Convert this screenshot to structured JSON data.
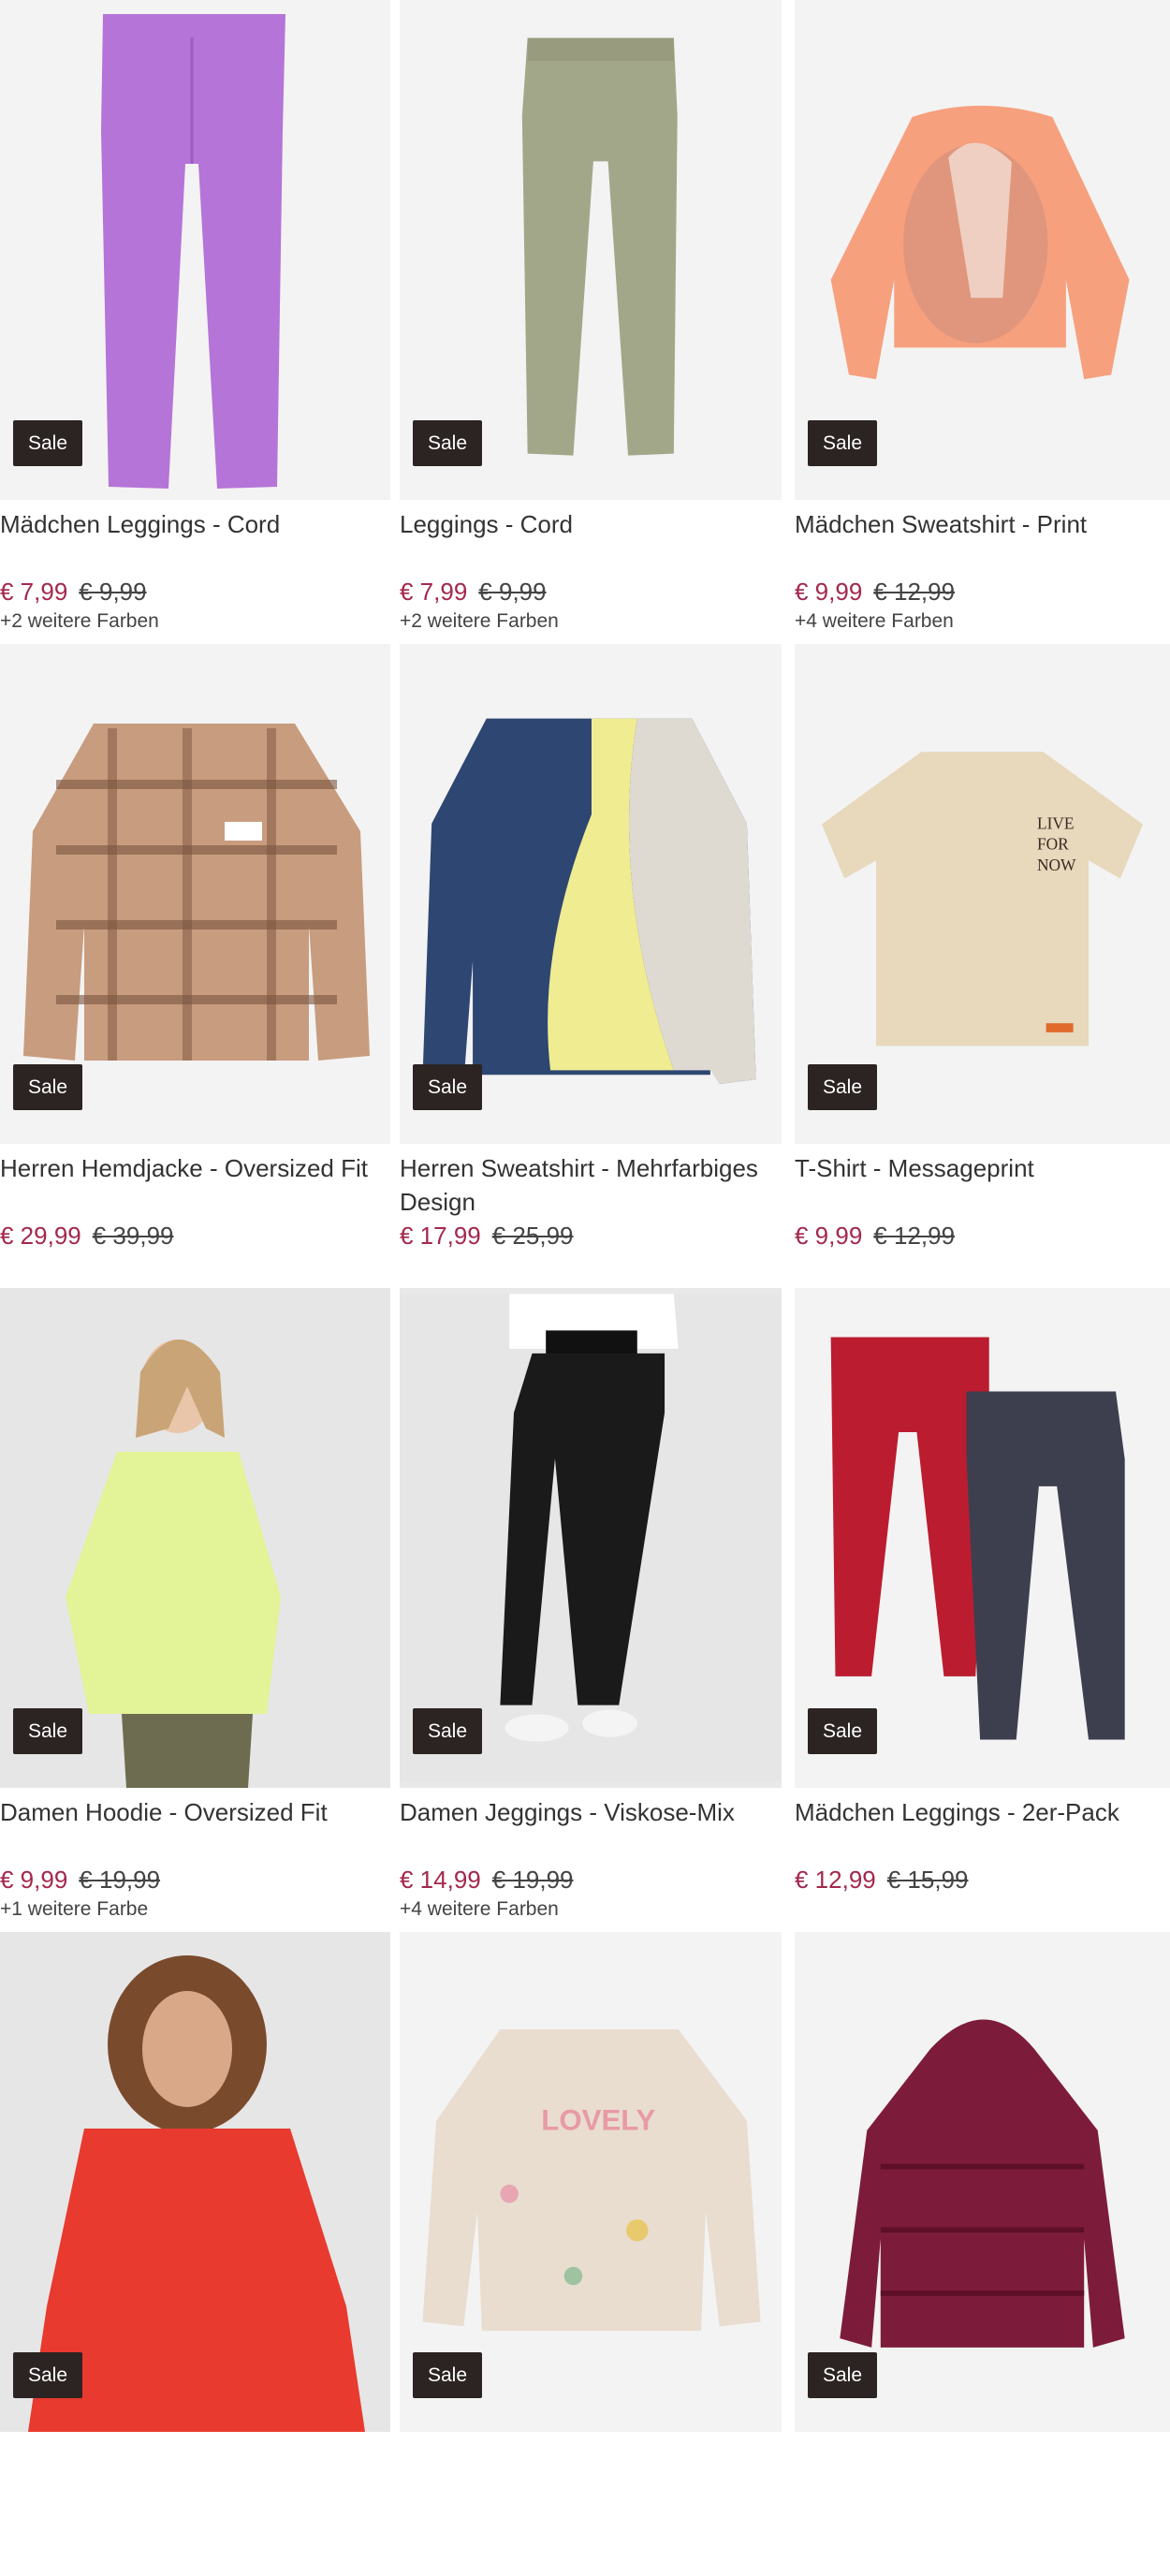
{
  "sale_label": "Sale",
  "colors": {
    "price": "#a3284c",
    "badge_bg": "#2b2422"
  },
  "products": [
    {
      "title": "Mädchen Leggings - Cord",
      "price": "€ 7,99",
      "old_price": "€ 9,99",
      "colors_note": "+2 weitere Farben"
    },
    {
      "title": "Leggings - Cord",
      "price": "€ 7,99",
      "old_price": "€ 9,99",
      "colors_note": "+2 weitere Farben"
    },
    {
      "title": "Mädchen Sweatshirt - Print",
      "price": "€ 9,99",
      "old_price": "€ 12,99",
      "colors_note": "+4 weitere Farben"
    },
    {
      "title": "Herren Hemdjacke - Oversized Fit",
      "price": "€ 29,99",
      "old_price": "€ 39,99",
      "colors_note": ""
    },
    {
      "title": "Herren Sweatshirt - Mehrfarbiges Design",
      "price": "€ 17,99",
      "old_price": "€ 25,99",
      "colors_note": ""
    },
    {
      "title": "T-Shirt - Messageprint",
      "price": "€ 9,99",
      "old_price": "€ 12,99",
      "colors_note": ""
    },
    {
      "title": "Damen Hoodie - Oversized Fit",
      "price": "€ 9,99",
      "old_price": "€ 19,99",
      "colors_note": "+1 weitere Farbe"
    },
    {
      "title": "Damen Jeggings - Viskose-Mix",
      "price": "€ 14,99",
      "old_price": "€ 19,99",
      "colors_note": "+4 weitere Farben"
    },
    {
      "title": "Mädchen Leggings - 2er-Pack",
      "price": "€ 12,99",
      "old_price": "€ 15,99",
      "colors_note": ""
    },
    {
      "title": "",
      "price": "",
      "old_price": "",
      "colors_note": ""
    },
    {
      "title": "",
      "price": "",
      "old_price": "",
      "colors_note": ""
    },
    {
      "title": "",
      "price": "",
      "old_price": "",
      "colors_note": ""
    }
  ]
}
